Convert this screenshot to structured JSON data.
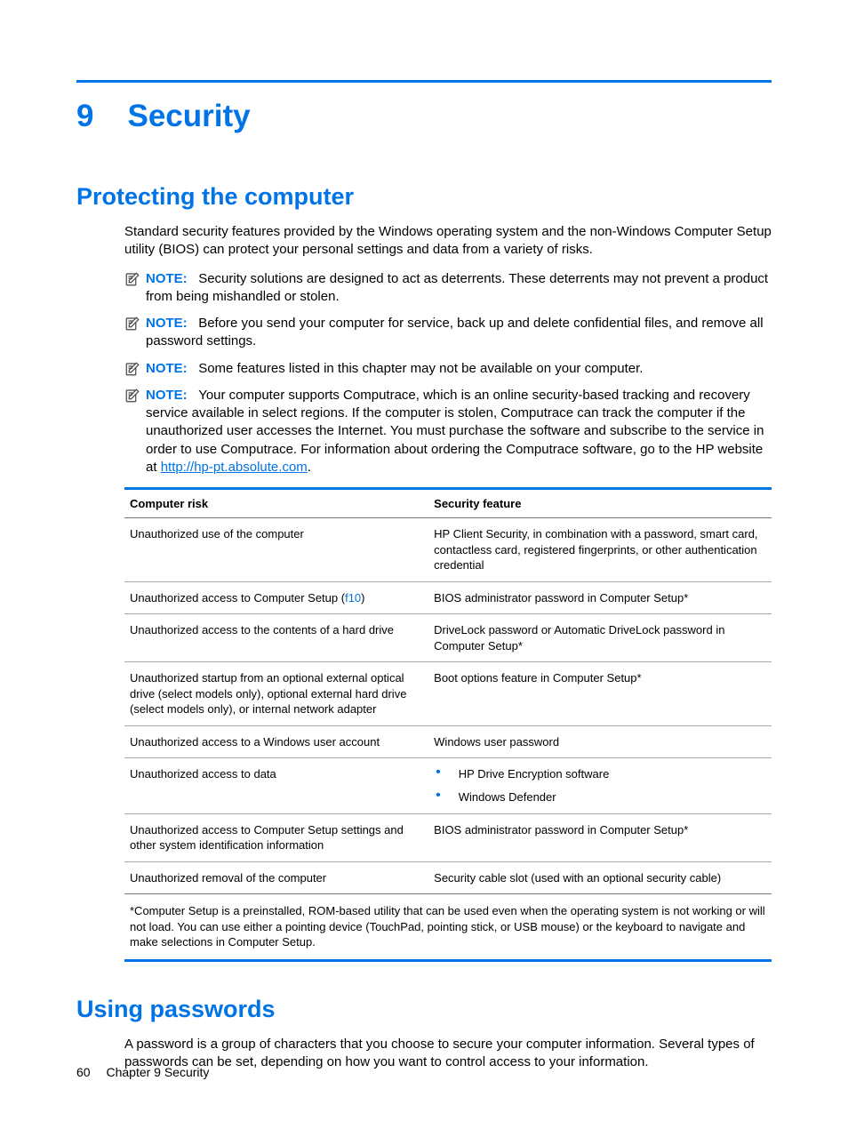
{
  "chapter": {
    "number": "9",
    "title": "Security"
  },
  "section1": {
    "heading": "Protecting the computer",
    "intro": "Standard security features provided by the Windows operating system and the non-Windows Computer Setup utility (BIOS) can protect your personal settings and data from a variety of risks.",
    "notes": {
      "label": "NOTE:",
      "n1": "Security solutions are designed to act as deterrents. These deterrents may not prevent a product from being mishandled or stolen.",
      "n2": "Before you send your computer for service, back up and delete confidential files, and remove all password settings.",
      "n3": "Some features listed in this chapter may not be available on your computer.",
      "n4a": "Your computer supports Computrace, which is an online security-based tracking and recovery service available in select regions. If the computer is stolen, Computrace can track the computer if the unauthorized user accesses the Internet. You must purchase the software and subscribe to the service in order to use Computrace. For information about ordering the Computrace software, go to the HP website at ",
      "n4link": "http://hp-pt.absolute.com",
      "n4b": "."
    },
    "table": {
      "h1": "Computer risk",
      "h2": "Security feature",
      "rows": [
        {
          "risk": "Unauthorized use of the computer",
          "feat": "HP Client Security, in combination with a password, smart card, contactless card, registered fingerprints, or other authentication credential"
        },
        {
          "risk_pre": "Unauthorized access to Computer Setup (",
          "risk_f10": "f10",
          "risk_post": ")",
          "feat": "BIOS administrator password in Computer Setup*"
        },
        {
          "risk": "Unauthorized access to the contents of a hard drive",
          "feat": "DriveLock password or Automatic DriveLock password in Computer Setup*"
        },
        {
          "risk": "Unauthorized startup from an optional external optical drive (select models only), optional external hard drive (select models only), or internal network adapter",
          "feat": "Boot options feature in Computer Setup*"
        },
        {
          "risk": "Unauthorized access to a Windows user account",
          "feat": "Windows user password"
        },
        {
          "risk": "Unauthorized access to data",
          "list": [
            "HP Drive Encryption software",
            "Windows Defender"
          ]
        },
        {
          "risk": "Unauthorized access to Computer Setup settings and other system identification information",
          "feat": "BIOS administrator password in Computer Setup*"
        },
        {
          "risk": "Unauthorized removal of the computer",
          "feat": "Security cable slot (used with an optional security cable)"
        }
      ],
      "footnote": "*Computer Setup is a preinstalled, ROM-based utility that can be used even when the operating system is not working or will not load. You can use either a pointing device (TouchPad, pointing stick, or USB mouse) or the keyboard to navigate and make selections in Computer Setup."
    }
  },
  "section2": {
    "heading": "Using passwords",
    "body": "A password is a group of characters that you choose to secure your computer information. Several types of passwords can be set, depending on how you want to control access to your information."
  },
  "footer": {
    "pageno": "60",
    "chapter_label": "Chapter 9   Security"
  }
}
